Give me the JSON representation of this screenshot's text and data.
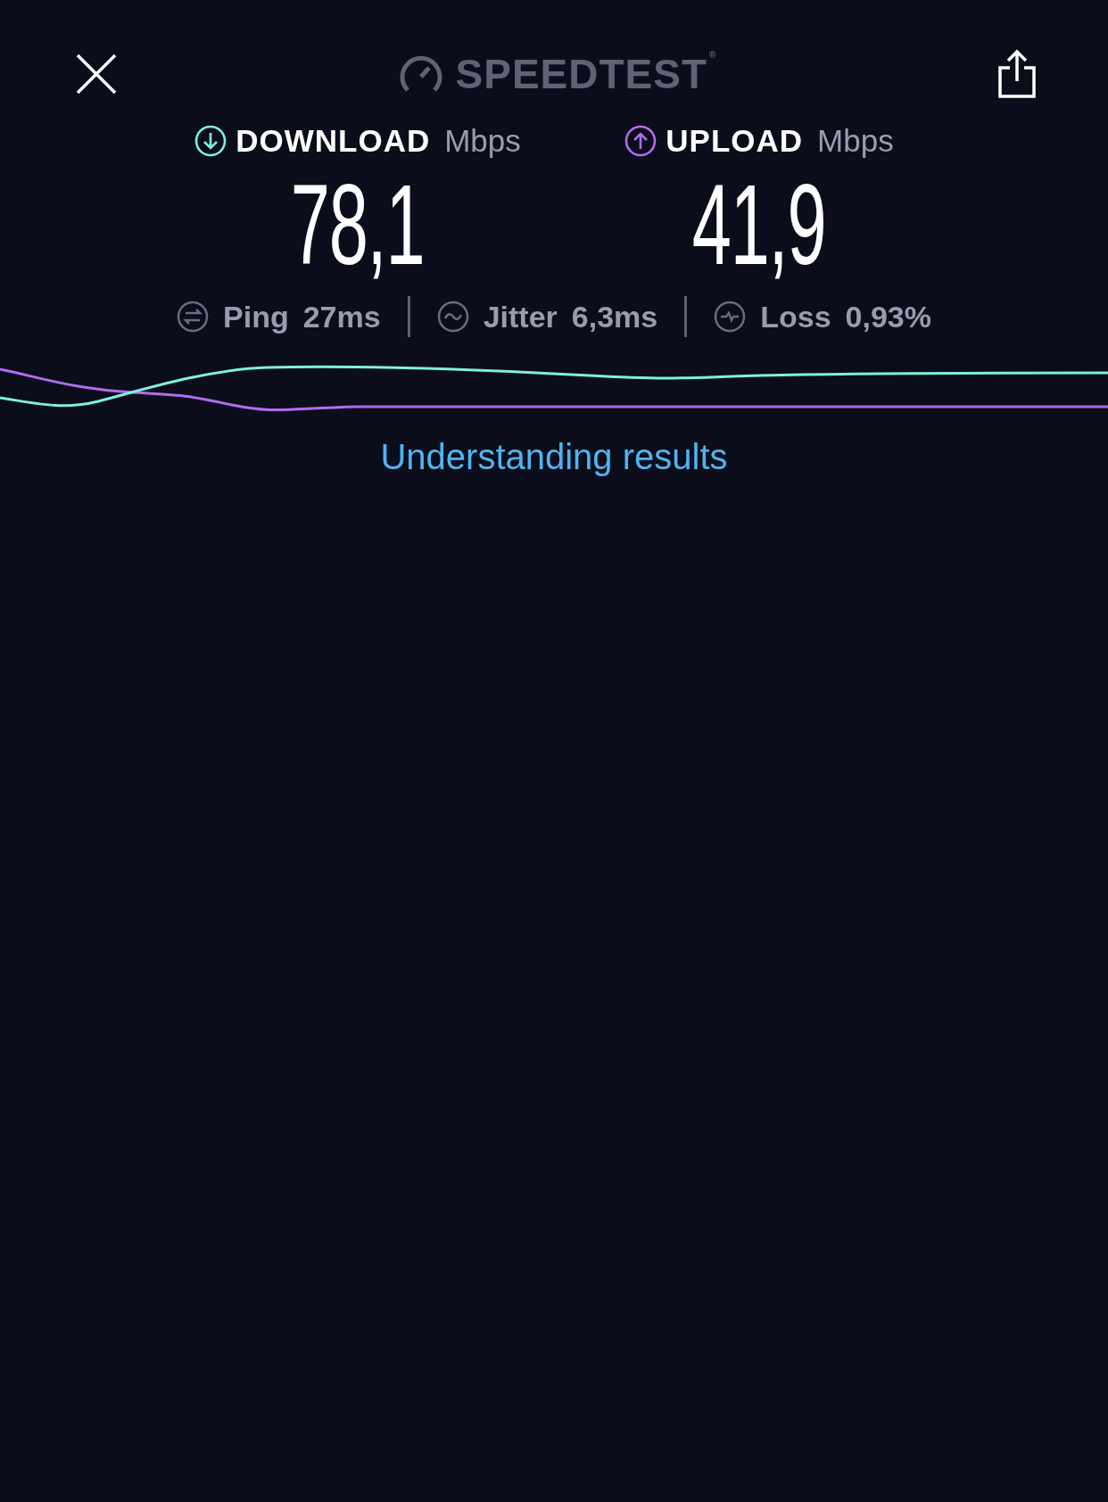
{
  "header": {
    "logo": "SPEEDTEST",
    "trademark": "®"
  },
  "results": [
    {
      "kind": "download",
      "label": "DOWNLOAD",
      "unit": "Mbps",
      "value": "78,1",
      "color": "#7ef0e0"
    },
    {
      "kind": "upload",
      "label": "UPLOAD",
      "unit": "Mbps",
      "value": "41,9",
      "color": "#b56af0"
    }
  ],
  "metrics": [
    {
      "kind": "ping",
      "label": "Ping",
      "value": "27",
      "unit": "ms"
    },
    {
      "kind": "jitter",
      "label": "Jitter",
      "value": "6,3",
      "unit": "ms"
    },
    {
      "kind": "loss",
      "label": "Loss",
      "value": "0,93",
      "unit": "%"
    }
  ],
  "link": "Understanding results"
}
